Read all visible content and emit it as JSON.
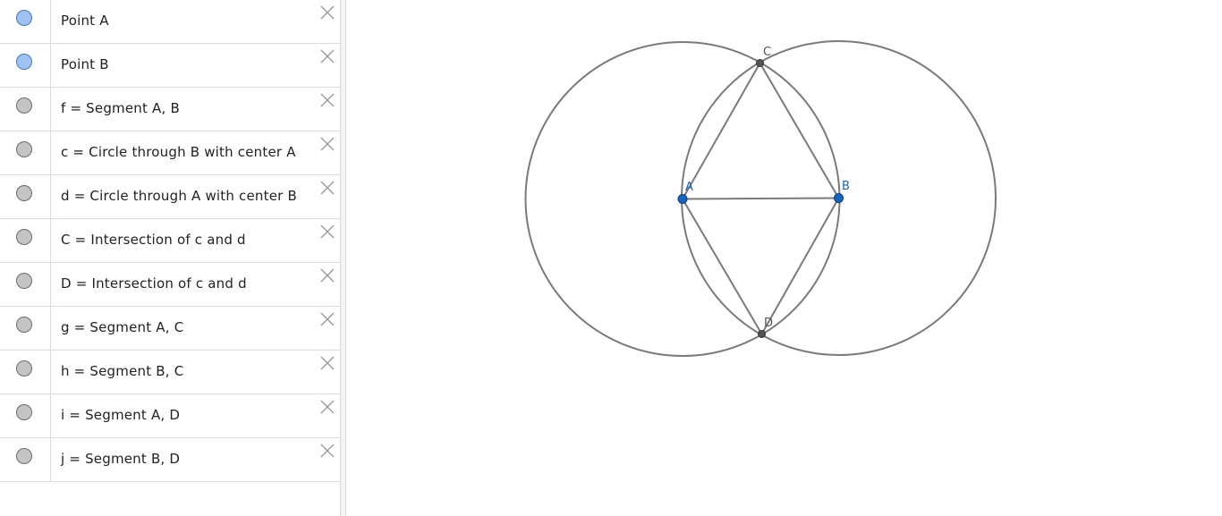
{
  "algebra_view": {
    "rows": [
      {
        "text": "Point A",
        "kind": "point"
      },
      {
        "text": "Point B",
        "kind": "point"
      },
      {
        "text": "f = Segment A, B",
        "kind": "object"
      },
      {
        "text": "c = Circle through B with center A",
        "kind": "object"
      },
      {
        "text": "d = Circle through A with center B",
        "kind": "object"
      },
      {
        "text": "C = Intersection of c and d",
        "kind": "object"
      },
      {
        "text": "D = Intersection of c and d",
        "kind": "object"
      },
      {
        "text": "g = Segment A, C",
        "kind": "object"
      },
      {
        "text": "h = Segment B, C",
        "kind": "object"
      },
      {
        "text": "i = Segment A, D",
        "kind": "object"
      },
      {
        "text": "j = Segment B, D",
        "kind": "object"
      }
    ],
    "delete_icon": "close-icon"
  },
  "graphics_view": {
    "labels": {
      "A": "A",
      "B": "B",
      "C": "C",
      "D": "D"
    },
    "colors": {
      "free_point": "#1565c0",
      "dependent_point": "#555555",
      "stroke": "#7a7a7a",
      "free_label": "#1565c0",
      "dependent_label": "#555555"
    }
  }
}
